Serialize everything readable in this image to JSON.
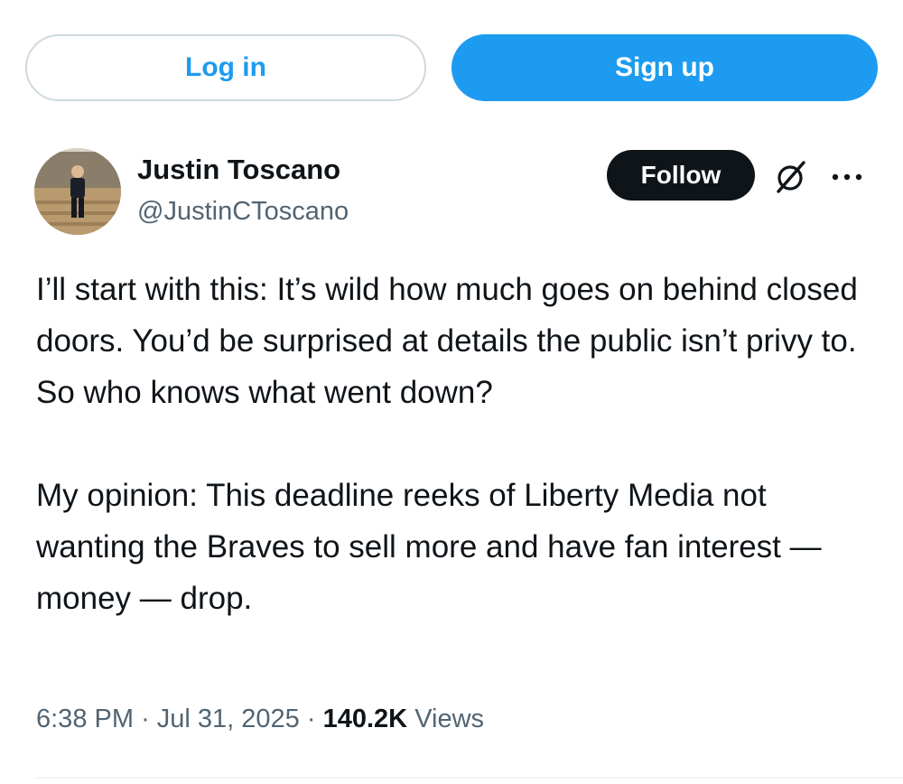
{
  "auth": {
    "login_label": "Log in",
    "signup_label": "Sign up"
  },
  "author": {
    "display_name": "Justin Toscano",
    "handle": "@JustinCToscano",
    "avatar_icon": "profile-photo",
    "follow_label": "Follow"
  },
  "icons": {
    "grok": "grok-icon",
    "more": "more-options-icon"
  },
  "tweet": {
    "paragraph_1": "I’ll start with this: It’s wild how much goes on behind closed doors. You’d be surprised at details the public isn’t privy to. So who knows what went down?",
    "paragraph_2": "My opinion: This deadline reeks of Liberty Media not wanting the Braves to sell more and have fan interest — money — drop."
  },
  "meta": {
    "time": "6:38 PM",
    "date": "Jul 31, 2025",
    "views_count": "140.2K",
    "views_label": "Views",
    "separator": "·"
  },
  "colors": {
    "accent": "#1d9bf0",
    "text": "#0f1419",
    "secondary": "#536471",
    "border": "#cfd9de"
  }
}
